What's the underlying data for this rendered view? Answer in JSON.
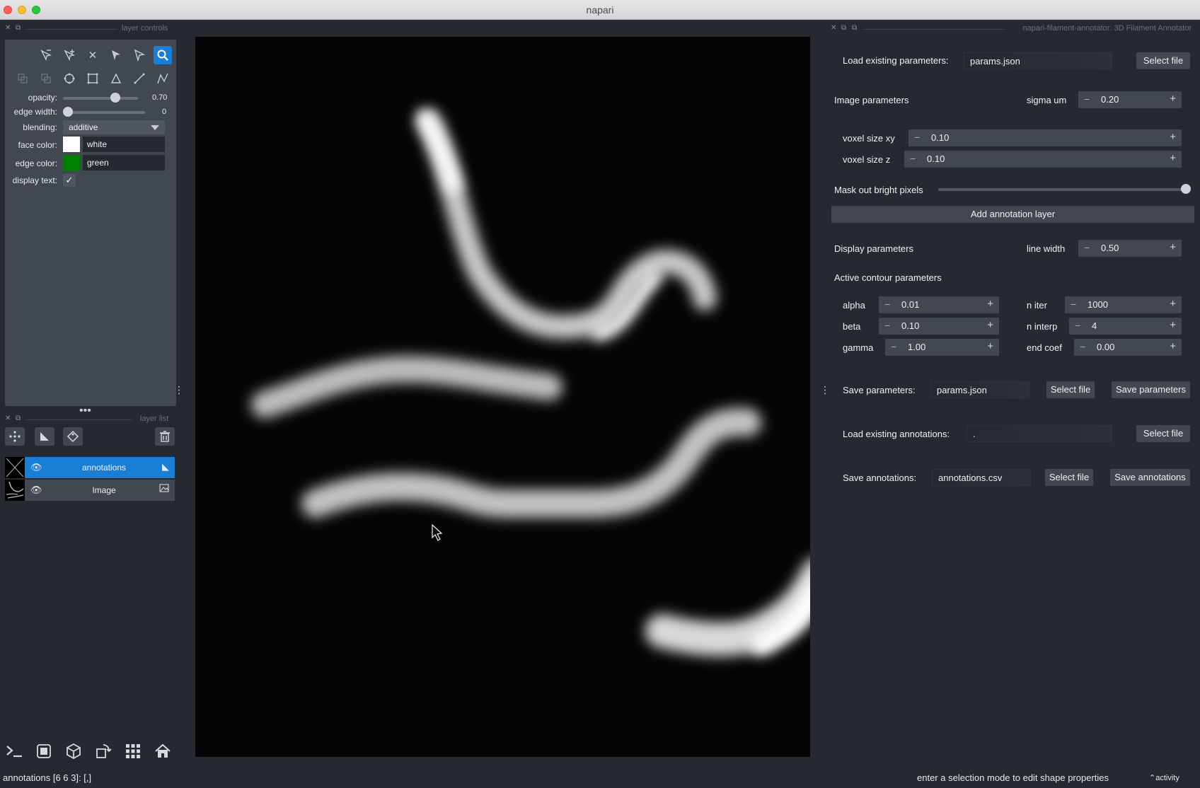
{
  "window": {
    "title": "napari"
  },
  "left_dock": {
    "controls_title": "layer controls",
    "layerlist_title": "layer list",
    "opacity": {
      "label": "opacity:",
      "value": "0.70",
      "fraction": 0.7
    },
    "edge_width": {
      "label": "edge width:",
      "value": "0",
      "fraction": 0.0
    },
    "blending": {
      "label": "blending:",
      "value": "additive"
    },
    "face_color": {
      "label": "face color:",
      "value": "white",
      "swatch": "#ffffff"
    },
    "edge_color": {
      "label": "edge color:",
      "value": "green",
      "swatch": "#008000"
    },
    "display_text": {
      "label": "display text:",
      "checked": true
    },
    "layers": [
      {
        "name": "annotations",
        "selected": true,
        "visible": true,
        "type_icon": "shapes-icon"
      },
      {
        "name": "Image",
        "selected": false,
        "visible": true,
        "type_icon": "image-icon"
      }
    ]
  },
  "plugin": {
    "title": "napari-filament-annotator: 3D Filament Annotator",
    "load_params_label": "Load existing parameters:",
    "load_params_value": "params.json",
    "select_file": "Select file",
    "image_params_label": "Image parameters",
    "sigma_label": "sigma um",
    "sigma_value": "0.20",
    "voxel_xy_label": "voxel size xy",
    "voxel_xy_value": "0.10",
    "voxel_z_label": "voxel size z",
    "voxel_z_value": "0.10",
    "mask_label": "Mask out bright pixels",
    "mask_fraction": 1.0,
    "add_layer_button": "Add annotation layer",
    "display_params_label": "Display parameters",
    "line_width_label": "line width",
    "line_width_value": "0.50",
    "active_contour_label": "Active contour parameters",
    "alpha_label": "alpha",
    "alpha_value": "0.01",
    "beta_label": "beta",
    "beta_value": "0.10",
    "gamma_label": "gamma",
    "gamma_value": "1.00",
    "n_iter_label": "n iter",
    "n_iter_value": "1000",
    "n_interp_label": "n interp",
    "n_interp_value": "4",
    "end_coef_label": "end coef",
    "end_coef_value": "0.00",
    "save_params_label": "Save parameters:",
    "save_params_value": "params.json",
    "save_params_button": "Save parameters",
    "load_annot_label": "Load existing annotations:",
    "load_annot_value": ".",
    "save_annot_label": "Save annotations:",
    "save_annot_value": "annotations.csv",
    "save_annot_button": "Save annotations"
  },
  "status": {
    "left": "annotations [6 6 3]: [,]",
    "right": "enter a selection mode to edit shape properties",
    "activity": "activity"
  },
  "colors": {
    "accent": "#1a7fd4",
    "background": "#262930",
    "panel": "#414851"
  }
}
